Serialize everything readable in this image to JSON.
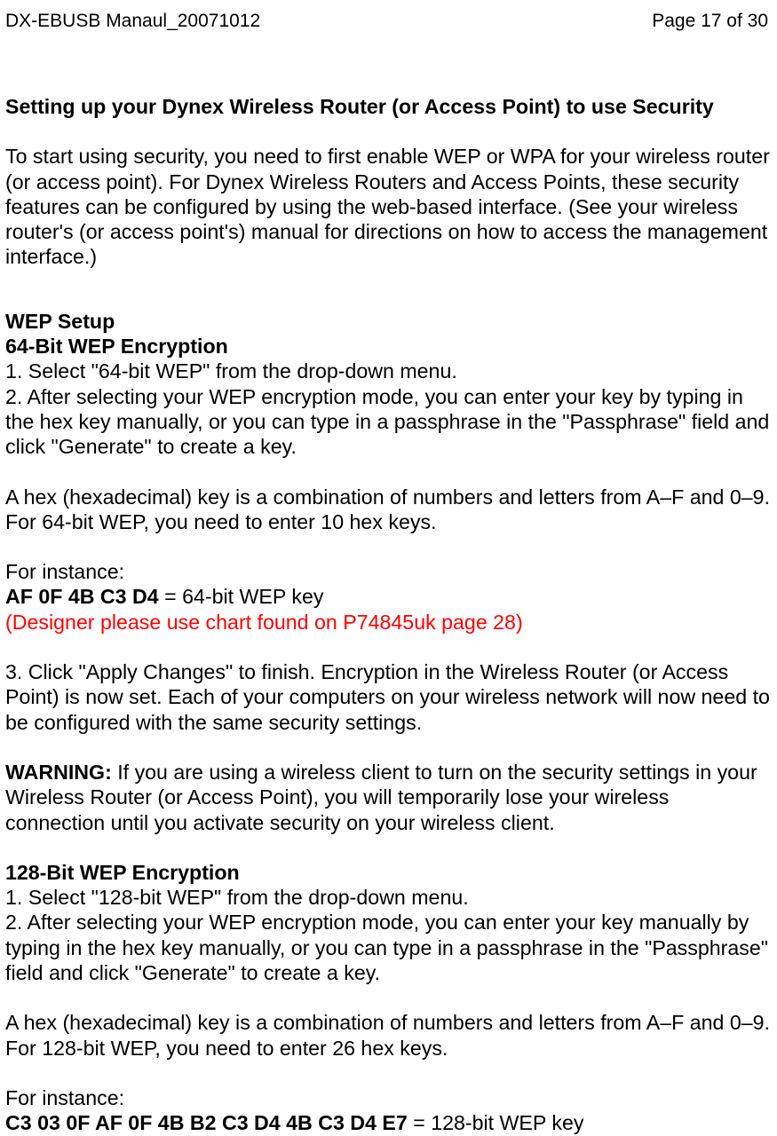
{
  "header": {
    "left": "DX-EBUSB Manaul_20071012",
    "right": "Page 17 of 30"
  },
  "sec1": {
    "title": "Setting up your Dynex Wireless Router (or Access Point) to use Security",
    "p1": "To start using security, you need to first enable WEP or WPA for your wireless router (or access point). For Dynex Wireless Routers and Access Points, these security features can be configured by using the web-based interface. (See your wireless router's (or access point's) manual for directions on how to access the management interface.)"
  },
  "wep": {
    "title": "WEP Setup",
    "sub64": "64-Bit WEP Encryption",
    "step1": "1. Select \"64-bit WEP\" from the drop-down menu.",
    "step2": "2. After selecting your WEP encryption mode, you can enter your key by typing in the hex key manually, or you can type in a passphrase in the \"Passphrase\" field and click \"Generate\" to create a key.",
    "hexnote": "A hex (hexadecimal) key is a combination of numbers and letters from A–F and 0–9. For 64-bit WEP, you need to enter 10 hex keys.",
    "forinstance": "For instance:",
    "keyexample": "AF 0F 4B C3 D4",
    "keyexample_suffix": " = 64-bit WEP key",
    "designer_note": "(Designer please use chart found on P74845uk page 28)",
    "step3": "3. Click \"Apply Changes\" to finish. Encryption in the Wireless Router (or Access Point) is now set. Each of your computers on your wireless network will now need to be configured with the same security settings.",
    "warning_label": "WARNING:",
    "warning": " If you are using a wireless client to turn on the security settings in your Wireless Router (or Access Point), you will temporarily lose your wireless connection until you activate security on your wireless client."
  },
  "wep128": {
    "title": "128-Bit WEP Encryption",
    "step1": "1. Select \"128-bit WEP\" from the drop-down menu.",
    "step2": "2. After selecting your WEP encryption mode, you can enter your key manually by typing in the hex key manually, or you can type in a passphrase in the \"Passphrase\" field and click \"Generate\" to create a key.",
    "hexnote": "A hex (hexadecimal) key is a combination of numbers and letters from A–F and 0–9. For 128-bit WEP, you need to enter 26 hex keys.",
    "forinstance": "For instance:",
    "keyexample": "C3 03 0F AF 0F 4B B2 C3 D4 4B C3 D4 E7",
    "keyexample_suffix": " = 128-bit WEP key"
  }
}
